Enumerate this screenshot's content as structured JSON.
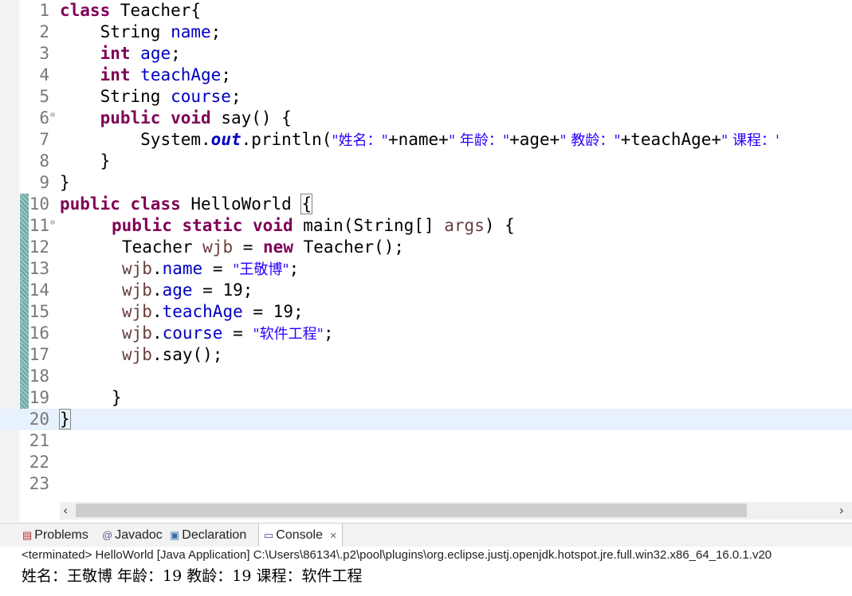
{
  "editor": {
    "line_numbers": [
      "1",
      "2",
      "3",
      "4",
      "5",
      "6",
      "7",
      "8",
      "9",
      "10",
      "11",
      "12",
      "13",
      "14",
      "15",
      "16",
      "17",
      "18",
      "19",
      "20",
      "21",
      "22",
      "23"
    ],
    "fold_glyph": "⊖",
    "lines": {
      "l1": {
        "kw": "class",
        "rest": " Teacher{"
      },
      "l2": {
        "type": "String",
        "field": "name",
        "end": ";"
      },
      "l3": {
        "kw": "int",
        "field": "age",
        "end": ";"
      },
      "l4": {
        "kw": "int",
        "field": "teachAge",
        "end": ";"
      },
      "l5": {
        "type": "String",
        "field": "course",
        "end": ";"
      },
      "l6": {
        "kw1": "public",
        "kw2": "void",
        "rest": " say() {"
      },
      "l7": {
        "a": "System.",
        "out": "out",
        "b": ".println(",
        "s1": "\"姓名：\"",
        "p1": "+name+",
        "s2": "\" 年龄：\"",
        "p2": "+age+",
        "s3": "\" 教龄：\"",
        "p3": "+teachAge+",
        "s4": "\" 课程：'"
      },
      "l8": {
        "rest": "}"
      },
      "l9": {
        "rest": "}"
      },
      "l10": {
        "kw1": "public",
        "kw2": "class",
        "rest": " HelloWorld ",
        "brace": "{"
      },
      "l11": {
        "kw1": "public",
        "kw2": "static",
        "kw3": "void",
        "a": " main(String[] ",
        "var": "args",
        "b": ") {"
      },
      "l12": {
        "a": "Teacher ",
        "var": "wjb",
        "b": " = ",
        "kw": "new",
        "c": " Teacher();"
      },
      "l13": {
        "var": "wjb",
        "dot": ".",
        "field": "name",
        "eq": " = ",
        "str": "\"王敬博\"",
        "end": ";"
      },
      "l14": {
        "var": "wjb",
        "dot": ".",
        "field": "age",
        "rest": " = 19;"
      },
      "l15": {
        "var": "wjb",
        "dot": ".",
        "field": "teachAge",
        "rest": " = 19;"
      },
      "l16": {
        "var": "wjb",
        "dot": ".",
        "field": "course",
        "eq": " = ",
        "str": "\"软件工程\"",
        "end": ";"
      },
      "l17": {
        "var": "wjb",
        "rest": ".say();"
      },
      "l19": {
        "rest": "}"
      },
      "l20": {
        "brace": "}"
      }
    }
  },
  "scrollbar": {
    "left": "‹",
    "right": "›"
  },
  "bottom_tabs": [
    {
      "label": "Problems",
      "icon": "problems-icon"
    },
    {
      "label": "Javadoc",
      "icon": "javadoc-icon"
    },
    {
      "label": "Declaration",
      "icon": "declaration-icon"
    },
    {
      "label": "Console",
      "icon": "console-icon",
      "close": "✕"
    }
  ],
  "console": {
    "header": "<terminated> HelloWorld [Java Application] C:\\Users\\86134\\.p2\\pool\\plugins\\org.eclipse.justj.openjdk.hotspot.jre.full.win32.x86_64_16.0.1.v20",
    "output": "姓名：王敬博 年龄：19 教龄：19 课程：软件工程"
  }
}
